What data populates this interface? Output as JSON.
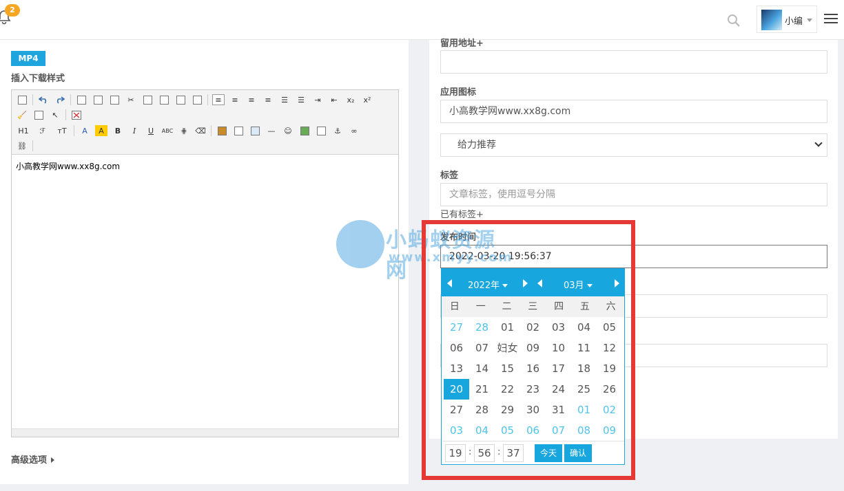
{
  "topbar": {
    "notification_count": "2",
    "user_name": "小编"
  },
  "left": {
    "mp4_label": "MP4",
    "insert_label": "插入下载样式",
    "toolbar_text": {
      "h1": "H1",
      "font": "ℱ",
      "size": "тT",
      "color_a": "A",
      "bg_a": "A",
      "bold": "B",
      "italic": "I",
      "underline": "U",
      "strike": "ABC"
    },
    "editor_content": "小高教学网www.xx8g.com",
    "advanced_label": "高级选项"
  },
  "right": {
    "url_label": "留用地址+",
    "icon_label": "应用图标",
    "icon_value": "小高教学网www.xx8g.com",
    "select_value": "给力推荐",
    "tags_label": "标签",
    "tags_placeholder": "文章标签，使用逗号分隔",
    "existing_tags": "已有标签+",
    "publish_label": "发布时间",
    "publish_value": "2022-03-20 19:56:37"
  },
  "picker": {
    "year_label": "2022年",
    "month_label": "03月",
    "weekdays": [
      "日",
      "一",
      "二",
      "三",
      "四",
      "五",
      "六"
    ],
    "rows": [
      [
        {
          "t": "27",
          "o": true
        },
        {
          "t": "28",
          "o": true
        },
        {
          "t": "01"
        },
        {
          "t": "02"
        },
        {
          "t": "03"
        },
        {
          "t": "04"
        },
        {
          "t": "05"
        }
      ],
      [
        {
          "t": "06"
        },
        {
          "t": "07"
        },
        {
          "t": "妇女"
        },
        {
          "t": "09"
        },
        {
          "t": "10"
        },
        {
          "t": "11"
        },
        {
          "t": "12"
        }
      ],
      [
        {
          "t": "13"
        },
        {
          "t": "14"
        },
        {
          "t": "15"
        },
        {
          "t": "16"
        },
        {
          "t": "17"
        },
        {
          "t": "18"
        },
        {
          "t": "19"
        }
      ],
      [
        {
          "t": "20",
          "s": true
        },
        {
          "t": "21"
        },
        {
          "t": "22"
        },
        {
          "t": "23"
        },
        {
          "t": "24"
        },
        {
          "t": "25"
        },
        {
          "t": "26"
        }
      ],
      [
        {
          "t": "27"
        },
        {
          "t": "28"
        },
        {
          "t": "29"
        },
        {
          "t": "30"
        },
        {
          "t": "31"
        },
        {
          "t": "01",
          "o": true
        },
        {
          "t": "02",
          "o": true
        }
      ],
      [
        {
          "t": "03",
          "o": true
        },
        {
          "t": "04",
          "o": true
        },
        {
          "t": "05",
          "o": true
        },
        {
          "t": "06",
          "o": true
        },
        {
          "t": "07",
          "o": true
        },
        {
          "t": "08",
          "o": true
        },
        {
          "t": "09",
          "o": true
        }
      ]
    ],
    "hour": "19",
    "minute": "56",
    "second": "37",
    "today_label": "今天",
    "confirm_label": "确认"
  },
  "watermark": {
    "line1": "小蚂蚁资源网",
    "line2": "www.xmyy.com"
  },
  "colors": {
    "accent": "#18a6df",
    "highlight_border": "#e53935",
    "badge": "#f5a623"
  }
}
